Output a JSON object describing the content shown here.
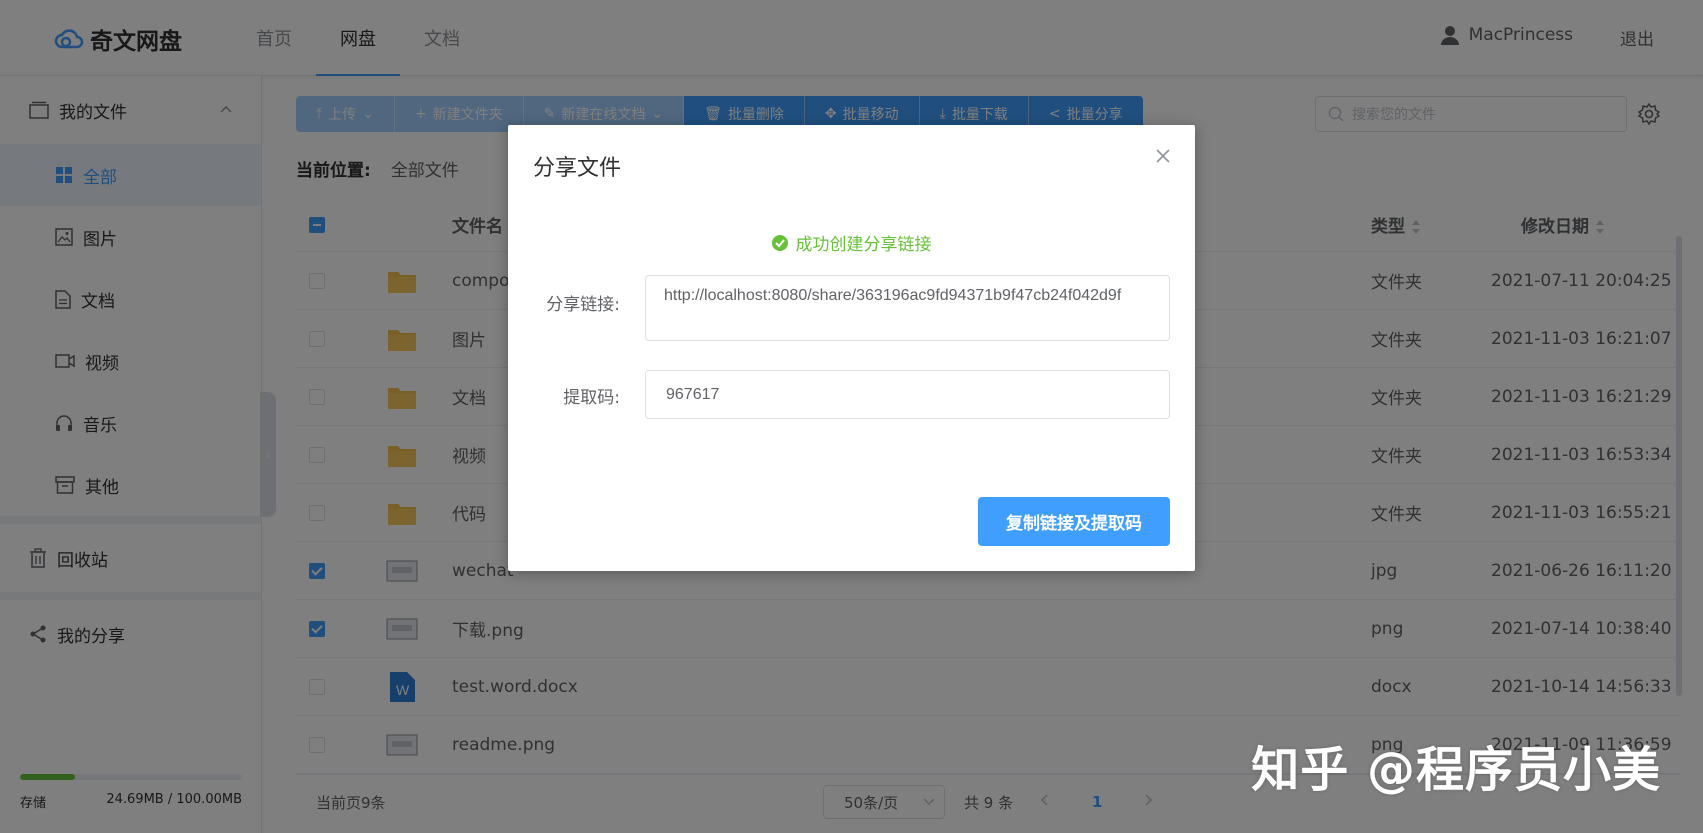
{
  "app": {
    "title": "奇文网盘"
  },
  "nav": {
    "items": [
      "首页",
      "网盘",
      "文档"
    ],
    "active": "网盘"
  },
  "user": {
    "name": "MacPrincess",
    "logout": "退出"
  },
  "sidebar": {
    "my_files": "我的文件",
    "items": [
      "全部",
      "图片",
      "文档",
      "视频",
      "音乐",
      "其他"
    ],
    "active": "全部",
    "recycle": "回收站",
    "my_share": "我的分享",
    "storage_label": "存储",
    "storage_value": "24.69MB / 100.00MB",
    "storage_fraction": 0.2469
  },
  "toolbar": {
    "upload": "上传",
    "new_folder": "新建文件夹",
    "new_doc": "新建在线文档",
    "batch_delete": "批量删除",
    "batch_move": "批量移动",
    "batch_download": "批量下载",
    "batch_share": "批量分享"
  },
  "search": {
    "placeholder": "搜索您的文件"
  },
  "location": {
    "label": "当前位置:",
    "value": "全部文件"
  },
  "table": {
    "headers": {
      "name": "文件名",
      "type": "类型",
      "date": "修改日期"
    },
    "rows": [
      {
        "name": "compor",
        "type": "文件夹",
        "date": "2021-07-11 20:04:25",
        "checked": false,
        "icon": "folder-icon"
      },
      {
        "name": "图片",
        "type": "文件夹",
        "date": "2021-11-03 16:21:07",
        "checked": false,
        "icon": "folder-icon"
      },
      {
        "name": "文档",
        "type": "文件夹",
        "date": "2021-11-03 16:21:29",
        "checked": false,
        "icon": "folder-icon"
      },
      {
        "name": "视频",
        "type": "文件夹",
        "date": "2021-11-03 16:53:34",
        "checked": false,
        "icon": "folder-icon"
      },
      {
        "name": "代码",
        "type": "文件夹",
        "date": "2021-11-03 16:55:21",
        "checked": false,
        "icon": "folder-icon"
      },
      {
        "name": "wechat",
        "type": "jpg",
        "date": "2021-06-26 16:11:20",
        "checked": true,
        "icon": "image-thumbnail-icon"
      },
      {
        "name": "下载.png",
        "type": "png",
        "date": "2021-07-14 10:38:40",
        "checked": true,
        "icon": "image-thumbnail-icon"
      },
      {
        "name": "test.word.docx",
        "type": "docx",
        "date": "2021-10-14 14:56:33",
        "checked": false,
        "icon": "word-icon"
      },
      {
        "name": "readme.png",
        "type": "png",
        "date": "2021-11-09 11:36:59",
        "checked": false,
        "icon": "image-thumbnail-icon"
      }
    ]
  },
  "pager": {
    "count": "当前页9条",
    "size": "50条/页",
    "total": "共 9 条",
    "page": "1"
  },
  "dialog": {
    "title": "分享文件",
    "success": "成功创建分享链接",
    "link_label": "分享链接:",
    "link_value": "http://localhost:8080/share/363196ac9fd94371b9f47cb24f042d9f",
    "code_label": "提取码:",
    "code_value": "967617",
    "copy_button": "复制链接及提取码"
  },
  "watermark": "知乎 @程序员小美",
  "colors": {
    "primary": "#409eff",
    "success": "#67c23a"
  }
}
